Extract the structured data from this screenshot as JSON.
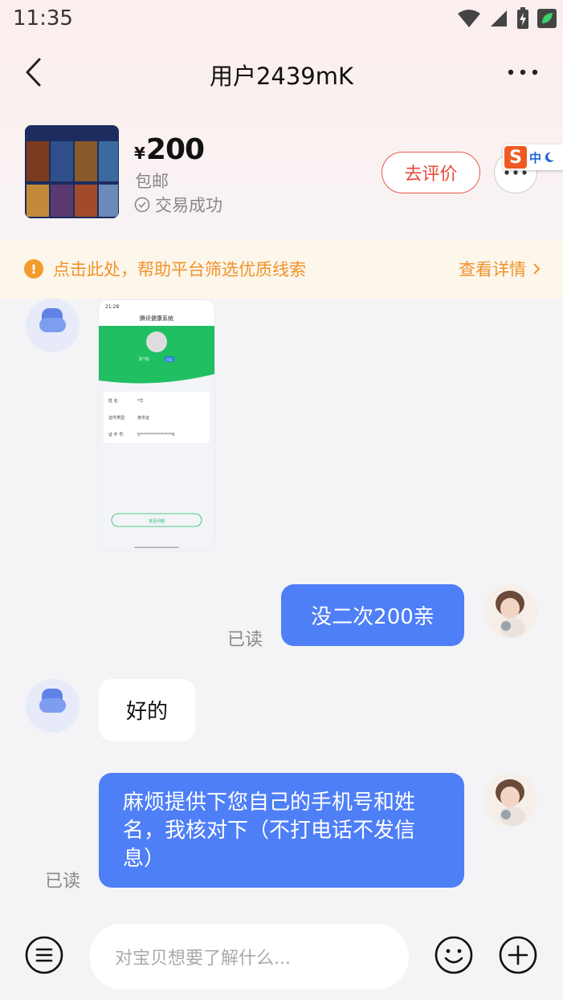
{
  "status_bar": {
    "time": "11:35"
  },
  "header": {
    "title": "用户2439mK"
  },
  "product": {
    "currency": "¥",
    "price": "200",
    "shipping": "包邮",
    "trade_status": "交易成功",
    "review_label": "去评价"
  },
  "ime": {
    "mode": "中"
  },
  "notice": {
    "text": "点击此处，帮助平台筛选优质线索",
    "link": "查看详情"
  },
  "screenshot_message": {
    "time": "21:28",
    "app_title": "腾讯健康系统",
    "name_short": "彭*钰",
    "badge": "已认",
    "rows": [
      {
        "label": "姓    名:",
        "value": "*华"
      },
      {
        "label": "证件类型:",
        "value": "身份证"
      },
      {
        "label": "证 件 号:",
        "value": "5****************6"
      }
    ],
    "faq_button": "常见问题"
  },
  "messages": [
    {
      "from": "self",
      "text": "没二次200亲",
      "status": "已读"
    },
    {
      "from": "other",
      "text": "好的"
    },
    {
      "from": "self",
      "text": "麻烦提供下您自己的手机号和姓名，我核对下（不打电话不发信息）",
      "status": "已读"
    }
  ],
  "input": {
    "placeholder": "对宝贝想要了解什么..."
  },
  "colors": {
    "accent": "#4f7ff7",
    "review": "#e8483b",
    "notice": "#f0922a"
  }
}
